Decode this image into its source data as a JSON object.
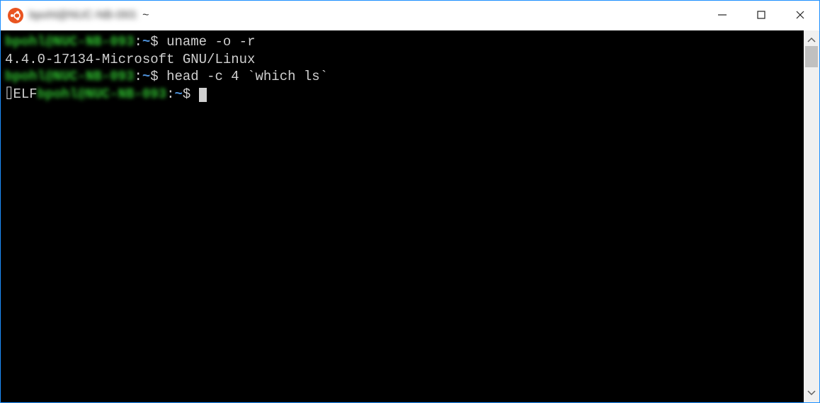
{
  "window": {
    "title_blurred": "bpohl@NUC-NB-093:",
    "title_suffix": "~",
    "icon_name": "ubuntu-icon"
  },
  "terminal": {
    "lines": [
      {
        "type": "prompt",
        "user_host": "bpohl@NUC-NB-093",
        "path": "~",
        "command": "uname -o -r"
      },
      {
        "type": "output",
        "text": "4.4.0-17134-Microsoft GNU/Linux"
      },
      {
        "type": "prompt",
        "user_host": "bpohl@NUC-NB-093",
        "path": "~",
        "command": "head -c 4 `which ls`"
      },
      {
        "type": "output_with_prompt",
        "prefix": "⌷ELF",
        "user_host": "bpohl@NUC-NB-093",
        "path": "~",
        "command": "",
        "has_cursor": true
      }
    ]
  },
  "colors": {
    "terminal_bg": "#000000",
    "terminal_fg": "#d0d0d0",
    "prompt_user": "#2fc22f",
    "prompt_path": "#4d8fd6",
    "window_border": "#1e90ff"
  }
}
